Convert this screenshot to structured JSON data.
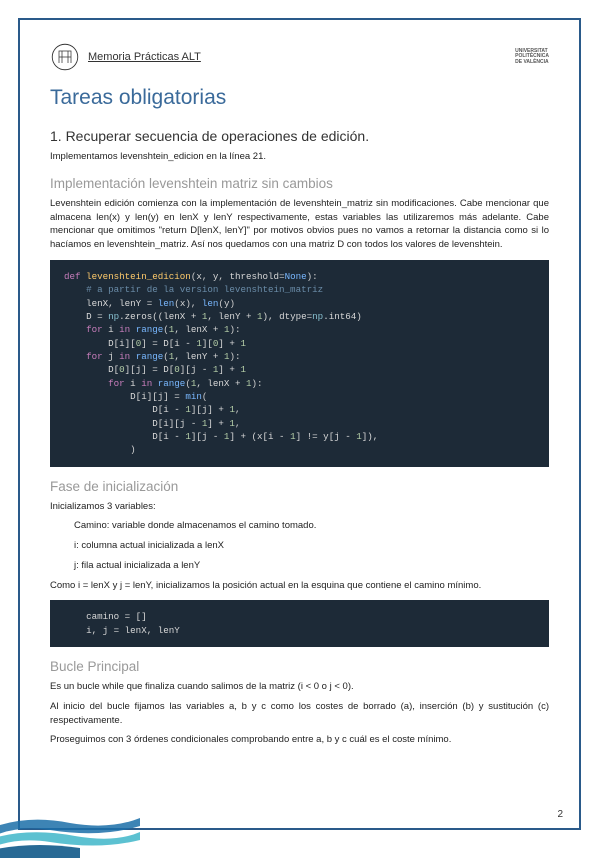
{
  "header": {
    "doc_title": "Memoria Prácticas ALT",
    "uni": "UNIVERSITAT\nPOLITÈCNICA\nDE VALÈNCIA"
  },
  "h1": "Tareas obligatorias",
  "s1": {
    "title": "1. Recuperar secuencia de operaciones de edición.",
    "intro": "Implementamos levenshtein_edicion en la línea 21."
  },
  "s2": {
    "title": "Implementación levenshtein matriz sin cambios",
    "p": "Levenshtein edición comienza con la implementación de levenshtein_matriz sin modificaciones. Cabe mencionar que almacena len(x) y len(y) en lenX y lenY respectivamente, estas variables las utilizaremos más adelante. Cabe mencionar que omitimos \"return D[lenX, lenY]\" por motivos obvios pues no vamos a retornar la distancia como si lo hacíamos en levenshtein_matriz. Así nos quedamos con una matriz D con todos los valores de levenshtein."
  },
  "code1": {
    "def": "def",
    "name": "levenshtein_edicion",
    "sig_open": "(",
    "x": "x",
    "y": "y",
    "threshold": "threshold",
    "none": "None",
    "sig_close": "):",
    "comment": "# a partir de la version levenshtein_matriz",
    "l3a": "lenX, lenY = ",
    "len": "len",
    "l4a": "D = ",
    "np": "np",
    "zeros": ".zeros((lenX + ",
    "one": "1",
    "l4b": ", lenY + ",
    "l4c": "), ",
    "dtype": "dtype",
    "eq": "=",
    "int64": ".int64)",
    "for": "for",
    "in": "in",
    "range": "range",
    "l5": " i ",
    "l5b": "(",
    "l5c": ", lenX + ",
    "l5d": "):",
    "l6": "D[i][",
    "zero": "0",
    "l6b": "] = D[i - ",
    "l6c": "][",
    "l6d": "] + ",
    "l7": " j ",
    "l7b": ", lenY + ",
    "l8": "D[",
    "l8b": "][j] = D[",
    "l8c": "][j - ",
    "l9": "D[i][j] = ",
    "min": "min",
    "l10": "D[i - ",
    "l10b": "][j] + ",
    "l11": "D[i][j - ",
    "l11b": "] + ",
    "l12": "][j - ",
    "l12b": "] + (x[i - ",
    "l12c": "] != y[j - ",
    "l12d": "]),",
    "close": ")"
  },
  "s3": {
    "title": "Fase de inicialización",
    "p1": "Inicializamos 3 variables:",
    "li1": "Camino: variable donde almacenamos el camino tomado.",
    "li2": "i: columna actual inicializada a lenX",
    "li3": "j: fila actual inicializada a lenY",
    "p2": "Como i = lenX y j = lenY, inicializamos la posición actual en la esquina que contiene el camino mínimo."
  },
  "code2": {
    "l1": "camino = []",
    "l2": "i, j = lenX, lenY"
  },
  "s4": {
    "title": "Bucle Principal",
    "p1": "Es un bucle while que finaliza cuando salimos de la matriz (i < 0 o j < 0).",
    "p2": "Al inicio del bucle fijamos las variables a, b y c como los costes de borrado (a), inserción (b) y sustitución (c) respectivamente.",
    "p3": "Proseguimos con 3 órdenes condicionales comprobando entre a, b y c cuál es el coste mínimo."
  },
  "page_number": "2"
}
